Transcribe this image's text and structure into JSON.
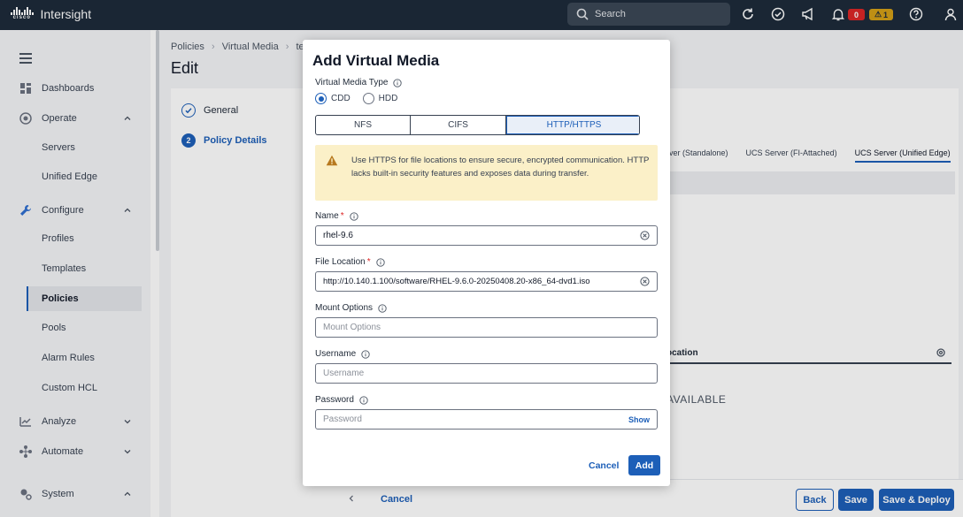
{
  "app": {
    "brand": "cisco",
    "title": "Intersight"
  },
  "topbar": {
    "search_label": "Search",
    "alerts_critical": "0",
    "alerts_warning": "1"
  },
  "sidebar": {
    "items": [
      {
        "label": "Dashboards",
        "icon": "dashboard-icon"
      },
      {
        "label": "Operate",
        "icon": "operate-icon",
        "expanded": true
      },
      {
        "label": "Servers"
      },
      {
        "label": "Unified Edge"
      },
      {
        "label": "Configure",
        "icon": "wrench-icon",
        "expanded": true
      },
      {
        "label": "Profiles"
      },
      {
        "label": "Templates"
      },
      {
        "label": "Policies",
        "active": true
      },
      {
        "label": "Pools"
      },
      {
        "label": "Alarm Rules"
      },
      {
        "label": "Custom HCL"
      },
      {
        "label": "Analyze",
        "icon": "analyze-icon",
        "expanded": false
      },
      {
        "label": "Automate",
        "icon": "automate-icon",
        "expanded": false
      },
      {
        "label": "System",
        "icon": "system-gear-icon",
        "expanded": true
      }
    ]
  },
  "page": {
    "breadcrumb": [
      "Policies",
      "Virtual Media",
      "te"
    ],
    "title": "Edit",
    "steps": [
      {
        "number": "1",
        "label": "General",
        "status": "done"
      },
      {
        "number": "2",
        "label": "Policy Details",
        "status": "current"
      }
    ],
    "content_tabs": [
      "rver (Standalone)",
      "UCS Server (FI-Attached)",
      "UCS Server (Unified Edge)"
    ],
    "table_header": "ocation",
    "empty_text": "AVAILABLE",
    "footer": {
      "cancel": "Cancel",
      "back": "Back",
      "save": "Save",
      "save_deploy": "Save & Deploy"
    }
  },
  "dialog": {
    "title": "Add Virtual Media",
    "type_label": "Virtual Media Type",
    "type_options": [
      "CDD",
      "HDD"
    ],
    "type_selected": "CDD",
    "protocol_tabs": [
      "NFS",
      "CIFS",
      "HTTP/HTTPS"
    ],
    "protocol_selected": "HTTP/HTTPS",
    "warning": "Use HTTPS for file locations to ensure secure, encrypted communication. HTTP lacks built-in security features and exposes data during transfer.",
    "name": {
      "label": "Name",
      "value": "rhel-9.6",
      "required": true
    },
    "file_location": {
      "label": "File Location",
      "value": "http://10.140.1.100/software/RHEL-9.6.0-20250408.20-x86_64-dvd1.iso",
      "required": true
    },
    "mount_options": {
      "label": "Mount Options",
      "placeholder": "Mount Options"
    },
    "username": {
      "label": "Username",
      "placeholder": "Username"
    },
    "password": {
      "label": "Password",
      "placeholder": "Password",
      "show_label": "Show"
    },
    "cancel_label": "Cancel",
    "add_label": "Add"
  },
  "colors": {
    "primary": "#1d5fb8",
    "topbar": "#1d2b3a",
    "warning_bg": "#fbf0c8",
    "error": "#dc2626"
  }
}
